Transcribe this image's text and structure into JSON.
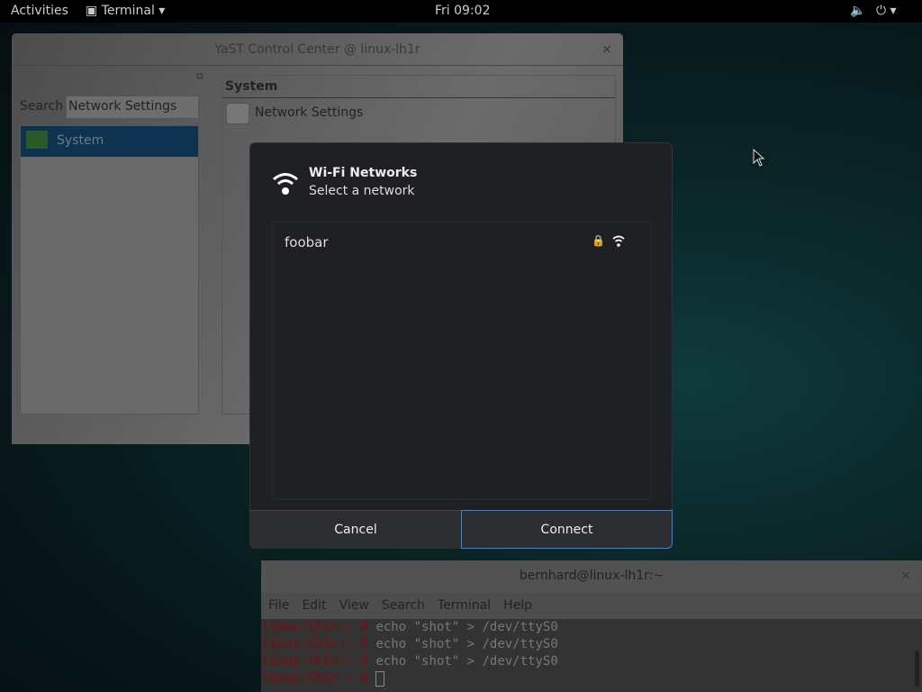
{
  "topbar": {
    "activities": "Activities",
    "app": "Terminal",
    "clock": "Fri 09:02"
  },
  "yast": {
    "title": "YaST Control Center @ linux-lh1r",
    "search_label": "Search",
    "search_value": "Network Settings",
    "categories": [
      "System"
    ],
    "group_header": "System",
    "modules": [
      "Network Settings"
    ]
  },
  "dialog": {
    "title": "Wi-Fi Networks",
    "subtitle": "Select a network",
    "networks": [
      {
        "name": "foobar",
        "secured": true,
        "signal": "strong"
      }
    ],
    "cancel": "Cancel",
    "connect": "Connect",
    "accent": "#3584e4"
  },
  "terminal": {
    "title": "bernhard@linux-lh1r:~",
    "menu": [
      "File",
      "Edit",
      "View",
      "Search",
      "Terminal",
      "Help"
    ],
    "prompt": "linux-lh1r:~ #",
    "lines": [
      "echo \"shot\" > /dev/ttyS0",
      "echo \"shot\" > /dev/ttyS0",
      "echo \"shot\" > /dev/ttyS0",
      ""
    ]
  }
}
